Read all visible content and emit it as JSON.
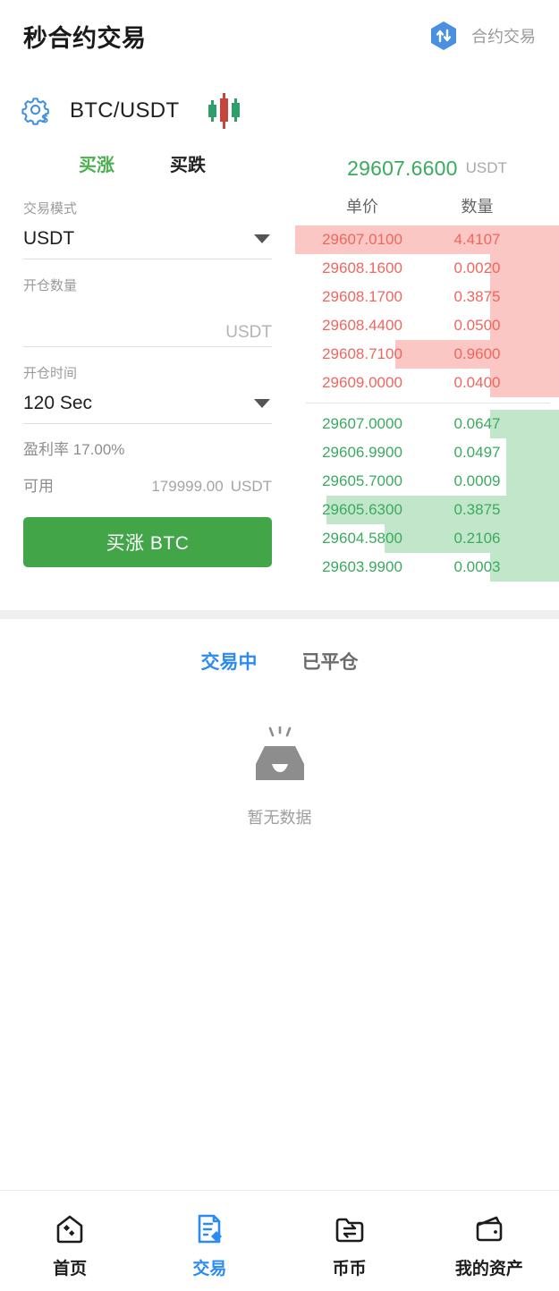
{
  "header": {
    "title": "秒合约交易",
    "right_label": "合约交易",
    "swap_icon": "swap-vertical-icon"
  },
  "pair": {
    "settings_icon": "gear-dollar-icon",
    "name": "BTC/USDT",
    "chart_icon": "candlestick-icon"
  },
  "form": {
    "tab_up": "买涨",
    "tab_down": "买跌",
    "mode_label": "交易模式",
    "mode_value": "USDT",
    "amount_label": "开仓数量",
    "amount_value": "",
    "amount_placeholder": "",
    "amount_unit": "USDT",
    "time_label": "开仓时间",
    "time_value": "120 Sec",
    "profit_label": "盈利率",
    "profit_value": "17.00%",
    "available_label": "可用",
    "available_value": "179999.00",
    "available_unit": "USDT",
    "submit_label": "买涨 BTC",
    "accent_green": "#42a648"
  },
  "orderbook": {
    "last_price": "29607.6600",
    "last_price_unit": "USDT",
    "col_price": "单价",
    "col_amount": "数量",
    "ask_color": "#f0665f",
    "ask_bar_color": "#fbc7c4",
    "bid_color": "#3aab5e",
    "bid_bar_color": "#c2e6ca",
    "asks": [
      {
        "price": "29607.0100",
        "amount": "4.4107",
        "depth": 100
      },
      {
        "price": "29608.1600",
        "amount": "0.0020",
        "depth": 26
      },
      {
        "price": "29608.1700",
        "amount": "0.3875",
        "depth": 26
      },
      {
        "price": "29608.4400",
        "amount": "0.0500",
        "depth": 26
      },
      {
        "price": "29608.7100",
        "amount": "0.9600",
        "depth": 62
      },
      {
        "price": "29609.0000",
        "amount": "0.0400",
        "depth": 26
      }
    ],
    "bids": [
      {
        "price": "29607.0000",
        "amount": "0.0647",
        "depth": 26
      },
      {
        "price": "29606.9900",
        "amount": "0.0497",
        "depth": 20
      },
      {
        "price": "29605.7000",
        "amount": "0.0009",
        "depth": 20
      },
      {
        "price": "29605.6300",
        "amount": "0.3875",
        "depth": 88
      },
      {
        "price": "29604.5800",
        "amount": "0.2106",
        "depth": 66
      },
      {
        "price": "29603.9900",
        "amount": "0.0003",
        "depth": 26
      }
    ]
  },
  "orders": {
    "tab_open": "交易中",
    "tab_closed": "已平仓",
    "active_tab": "交易中",
    "empty_icon": "empty-inbox-icon",
    "empty_text": "暂无数据",
    "active_color": "#2b8bf2"
  },
  "bottom_nav": {
    "active": "交易",
    "items": [
      {
        "label": "首页",
        "icon": "home-icon"
      },
      {
        "label": "交易",
        "icon": "trade-document-icon"
      },
      {
        "label": "币币",
        "icon": "exchange-folder-icon"
      },
      {
        "label": "我的资产",
        "icon": "wallet-icon"
      }
    ]
  }
}
